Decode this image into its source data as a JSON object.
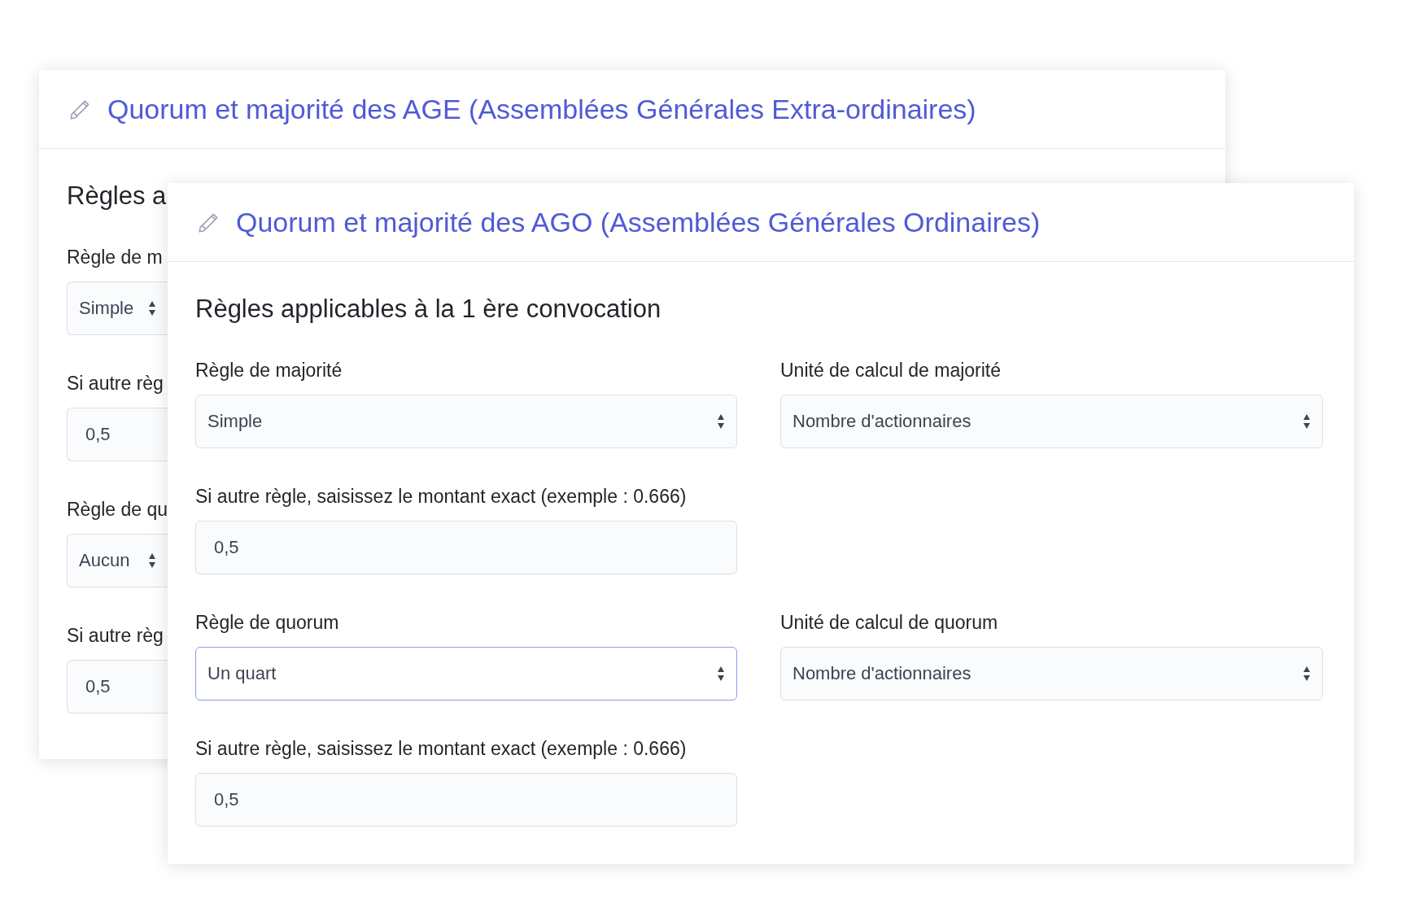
{
  "cards": [
    {
      "title": "Quorum et majorité des AGE (Assemblées Générales Extra-ordinaires)",
      "section_title": "Règles a",
      "rows": [
        [
          {
            "kind": "select",
            "label": "Règle de m",
            "value": "Simple",
            "focused": false
          }
        ],
        [
          {
            "kind": "input",
            "label": "Si autre règ",
            "value": "0,5",
            "focused": false
          }
        ],
        [
          {
            "kind": "select",
            "label": "Règle de qu",
            "value": "Aucun",
            "focused": false
          }
        ],
        [
          {
            "kind": "input",
            "label": "Si autre règ",
            "value": "0,5",
            "focused": false
          }
        ]
      ]
    },
    {
      "title": "Quorum et majorité des AGO (Assemblées Générales Ordinaires)",
      "section_title": "Règles applicables à la 1 ère convocation",
      "rows": [
        [
          {
            "kind": "select",
            "label": "Règle de majorité",
            "value": "Simple",
            "focused": false
          },
          {
            "kind": "select",
            "label": "Unité de calcul de majorité",
            "value": "Nombre d'actionnaires",
            "focused": false
          }
        ],
        [
          {
            "kind": "input",
            "label": "Si autre règle, saisissez le montant exact (exemple : 0.666)",
            "value": "0,5",
            "focused": false
          }
        ],
        [
          {
            "kind": "select",
            "label": "Règle de quorum",
            "value": "Un quart",
            "focused": true
          },
          {
            "kind": "select",
            "label": "Unité de calcul de quorum",
            "value": "Nombre d'actionnaires",
            "focused": false
          }
        ],
        [
          {
            "kind": "input",
            "label": "Si autre règle, saisissez le montant exact (exemple : 0.666)",
            "value": "0,5",
            "focused": false
          }
        ]
      ]
    }
  ]
}
